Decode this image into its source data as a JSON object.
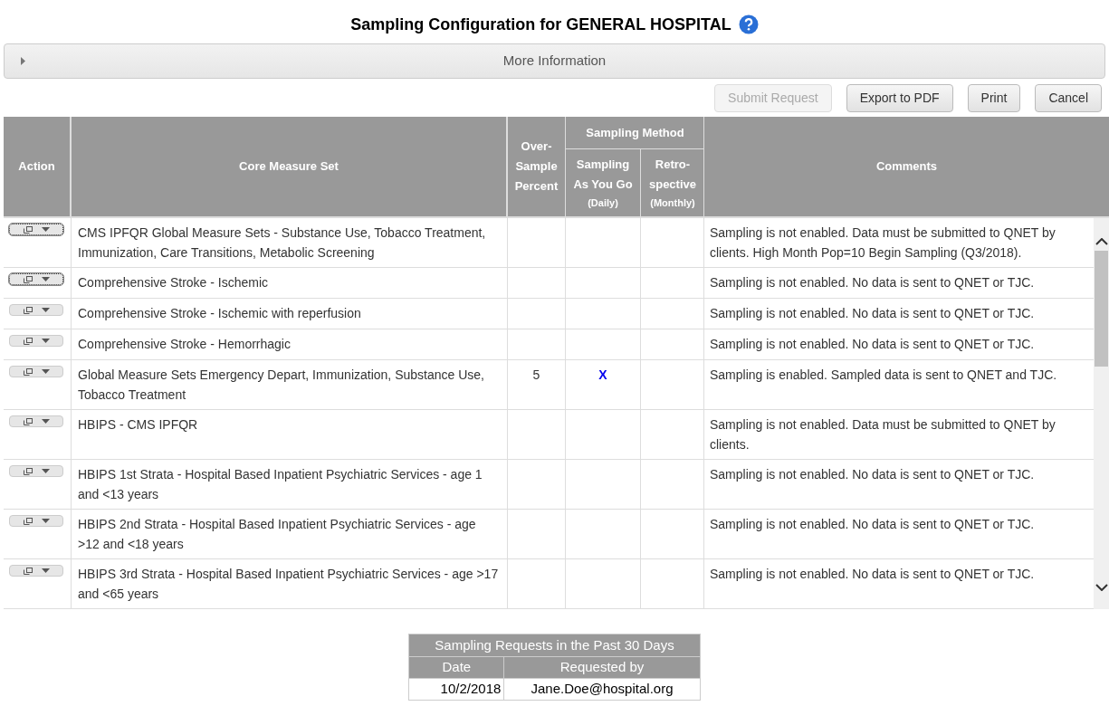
{
  "title": "Sampling Configuration for GENERAL HOSPITAL",
  "more_info": {
    "label": "More Information",
    "expanded": false
  },
  "buttons": [
    {
      "label": "Submit Request",
      "disabled": true
    },
    {
      "label": "Export to PDF",
      "disabled": false
    },
    {
      "label": "Print",
      "disabled": false
    },
    {
      "label": "Cancel",
      "disabled": false
    }
  ],
  "table": {
    "columns": {
      "action": "Action",
      "measure": "Core Measure Set",
      "over_sample": "Over-Sample Percent",
      "group": "Sampling Method",
      "as_you_go": "Sampling As You Go",
      "as_you_go_sub": "(Daily)",
      "retro": "Retro-spective",
      "retro_sub": "(Monthly)",
      "comments": "Comments"
    },
    "rows": [
      {
        "focused": true,
        "measure": "CMS IPFQR Global Measure Sets - Substance Use, Tobacco Treatment, Immunization, Care Transitions, Metabolic Screening",
        "comment": "Sampling is not enabled. Data must be submitted to QNET by clients. High Month Pop=10 Begin Sampling (Q3/2018)."
      },
      {
        "focused": true,
        "measure": "Comprehensive Stroke - Ischemic",
        "comment": "Sampling is not enabled. No data is sent to QNET or TJC."
      },
      {
        "focused": false,
        "measure": "Comprehensive Stroke - Ischemic with reperfusion",
        "comment": "Sampling is not enabled. No data is sent to QNET or TJC."
      },
      {
        "focused": false,
        "measure": "Comprehensive Stroke - Hemorrhagic",
        "comment": "Sampling is not enabled. No data is sent to QNET or TJC."
      },
      {
        "focused": false,
        "measure": "Global Measure Sets Emergency Depart, Immunization, Substance Use, Tobacco Treatment",
        "over_sample": "5",
        "as_you_go": "X",
        "comment": "Sampling is enabled. Sampled data is sent to QNET and TJC."
      },
      {
        "focused": false,
        "measure": "HBIPS - CMS IPFQR",
        "comment": "Sampling is not enabled. Data must be submitted to QNET by clients."
      },
      {
        "focused": false,
        "measure": "HBIPS 1st Strata - Hospital Based Inpatient Psychiatric Services - age 1 and <13 years",
        "comment": "Sampling is not enabled. No data is sent to QNET or TJC."
      },
      {
        "focused": false,
        "measure": "HBIPS 2nd Strata - Hospital Based Inpatient Psychiatric Services - age >12 and <18 years",
        "comment": "Sampling is not enabled. No data is sent to QNET or TJC."
      },
      {
        "focused": false,
        "measure": "HBIPS 3rd Strata - Hospital Based Inpatient Psychiatric Services - age >17 and <65 years",
        "comment": "Sampling is not enabled. No data is sent to QNET or TJC."
      }
    ]
  },
  "requests": {
    "title": "Sampling Requests in the Past 30 Days",
    "columns": [
      "Date",
      "Requested by"
    ],
    "rows": [
      [
        "10/2/2018",
        "Jane.Doe@hospital.org"
      ]
    ]
  }
}
